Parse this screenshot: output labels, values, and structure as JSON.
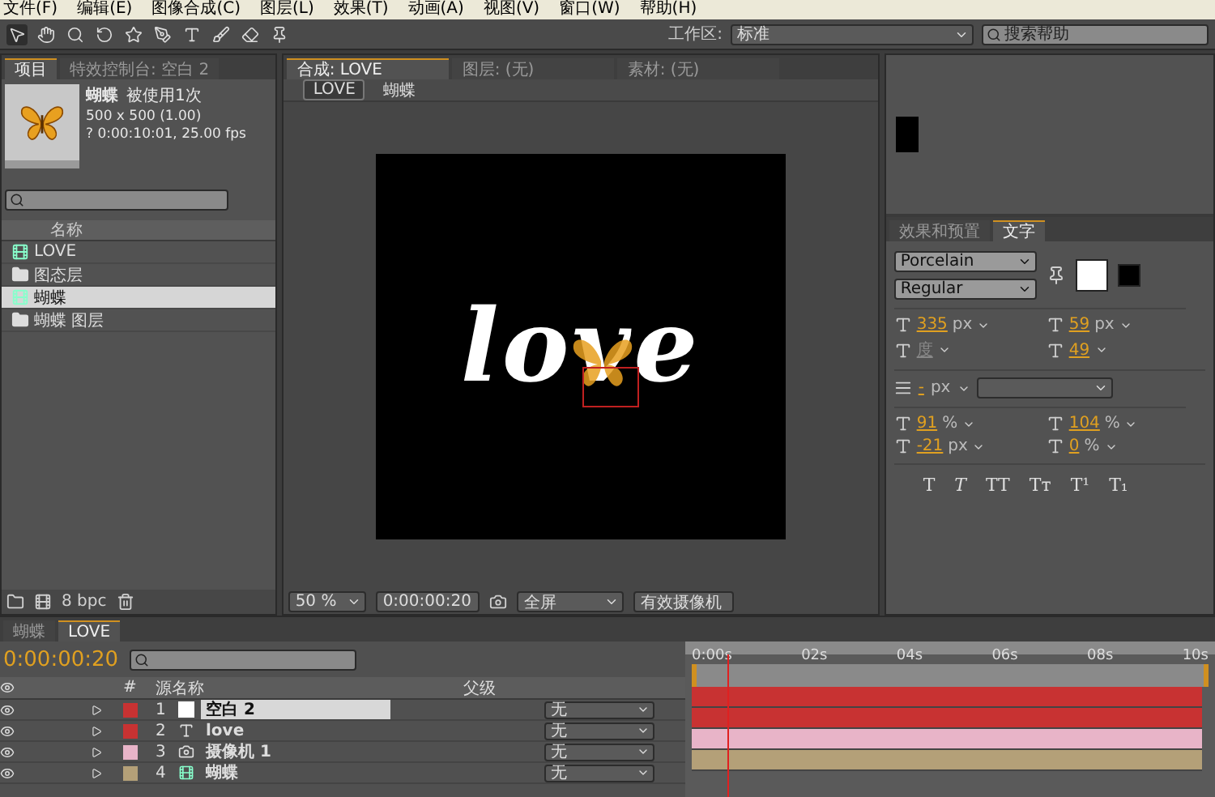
{
  "menu": [
    "文件(F)",
    "编辑(E)",
    "图像合成(C)",
    "图层(L)",
    "效果(T)",
    "动画(A)",
    "视图(V)",
    "窗口(W)",
    "帮助(H)"
  ],
  "toolbar": {
    "workspace_label": "工作区:",
    "workspace": "标准",
    "search": {
      "placeholder": "搜索帮助"
    }
  },
  "project_panel": {
    "tabs": [
      {
        "label": "项目",
        "selected": true
      },
      {
        "label": "特效控制台: 空白 2",
        "selected": false
      }
    ],
    "preview": {
      "name": "蝴蝶",
      "usage": "被使用1次",
      "size": "500 x 500 (1.00)",
      "duration": "? 0:00:10:01, 25.00 fps"
    },
    "column": "名称",
    "items": [
      {
        "name": "LOVE",
        "kind": "comp",
        "selected": false
      },
      {
        "name": "图态层",
        "kind": "folder",
        "selected": false
      },
      {
        "name": "蝴蝶",
        "kind": "comp",
        "selected": true
      },
      {
        "name": "蝴蝶 图层",
        "kind": "folder",
        "selected": false
      }
    ],
    "bit_depth": "8 bpc"
  },
  "comp_panel": {
    "tabs": [
      {
        "label": "合成: LOVE",
        "selected": true
      },
      {
        "label": "图层: (无)",
        "selected": false
      },
      {
        "label": "素材: (无)",
        "selected": false
      }
    ],
    "breadcrumb": [
      "LOVE",
      "蝴蝶"
    ],
    "canvas_text": "love",
    "zoom": "50 %",
    "timecode": "0:00:00:20",
    "resolution": "全屏",
    "camera": "有效摄像机"
  },
  "character_panel": {
    "tabs": [
      {
        "label": "效果和预置",
        "selected": false
      },
      {
        "label": "文字",
        "selected": true
      }
    ],
    "font": "Porcelain",
    "style": "Regular",
    "fields": [
      {
        "value": "335",
        "unit": "px",
        "disabled": false
      },
      {
        "value": "59",
        "unit": "px",
        "disabled": false
      },
      {
        "value": "度",
        "disabled": true
      },
      {
        "value": "49",
        "disabled": false
      }
    ],
    "stroke": {
      "value": "-",
      "unit": "px"
    },
    "scale_fields": [
      {
        "value": "91",
        "unit": "%"
      },
      {
        "value": "104",
        "unit": "%"
      },
      {
        "value": "-21",
        "unit": "px"
      },
      {
        "value": "0",
        "unit": "%"
      }
    ],
    "style_buttons": [
      "T",
      "T",
      "TT",
      "Tт",
      "T¹",
      "T₁"
    ]
  },
  "timeline": {
    "tabs": [
      {
        "label": "蝴蝶",
        "selected": false
      },
      {
        "label": "LOVE",
        "selected": true
      }
    ],
    "timecode": "0:00:00:20",
    "columns": {
      "number": "#",
      "source": "源名称",
      "parent": "父级"
    },
    "ruler": [
      "0:00s",
      "02s",
      "04s",
      "06s",
      "08s",
      "10s"
    ],
    "playhead": {
      "level": 0.07
    },
    "layers": [
      {
        "number": "1",
        "name": "空白 2",
        "kind": "solid",
        "color": "#c83232",
        "selected": true,
        "parent": "无"
      },
      {
        "number": "2",
        "name": "love",
        "kind": "text",
        "color": "#c83232",
        "selected": false,
        "parent": "无"
      },
      {
        "number": "3",
        "name": "摄像机 1",
        "kind": "camera",
        "color": "#e8b4c8",
        "selected": false,
        "parent": "无"
      },
      {
        "number": "4",
        "name": "蝴蝶",
        "kind": "comp",
        "color": "#b4a078",
        "selected": false,
        "parent": "无"
      }
    ]
  }
}
